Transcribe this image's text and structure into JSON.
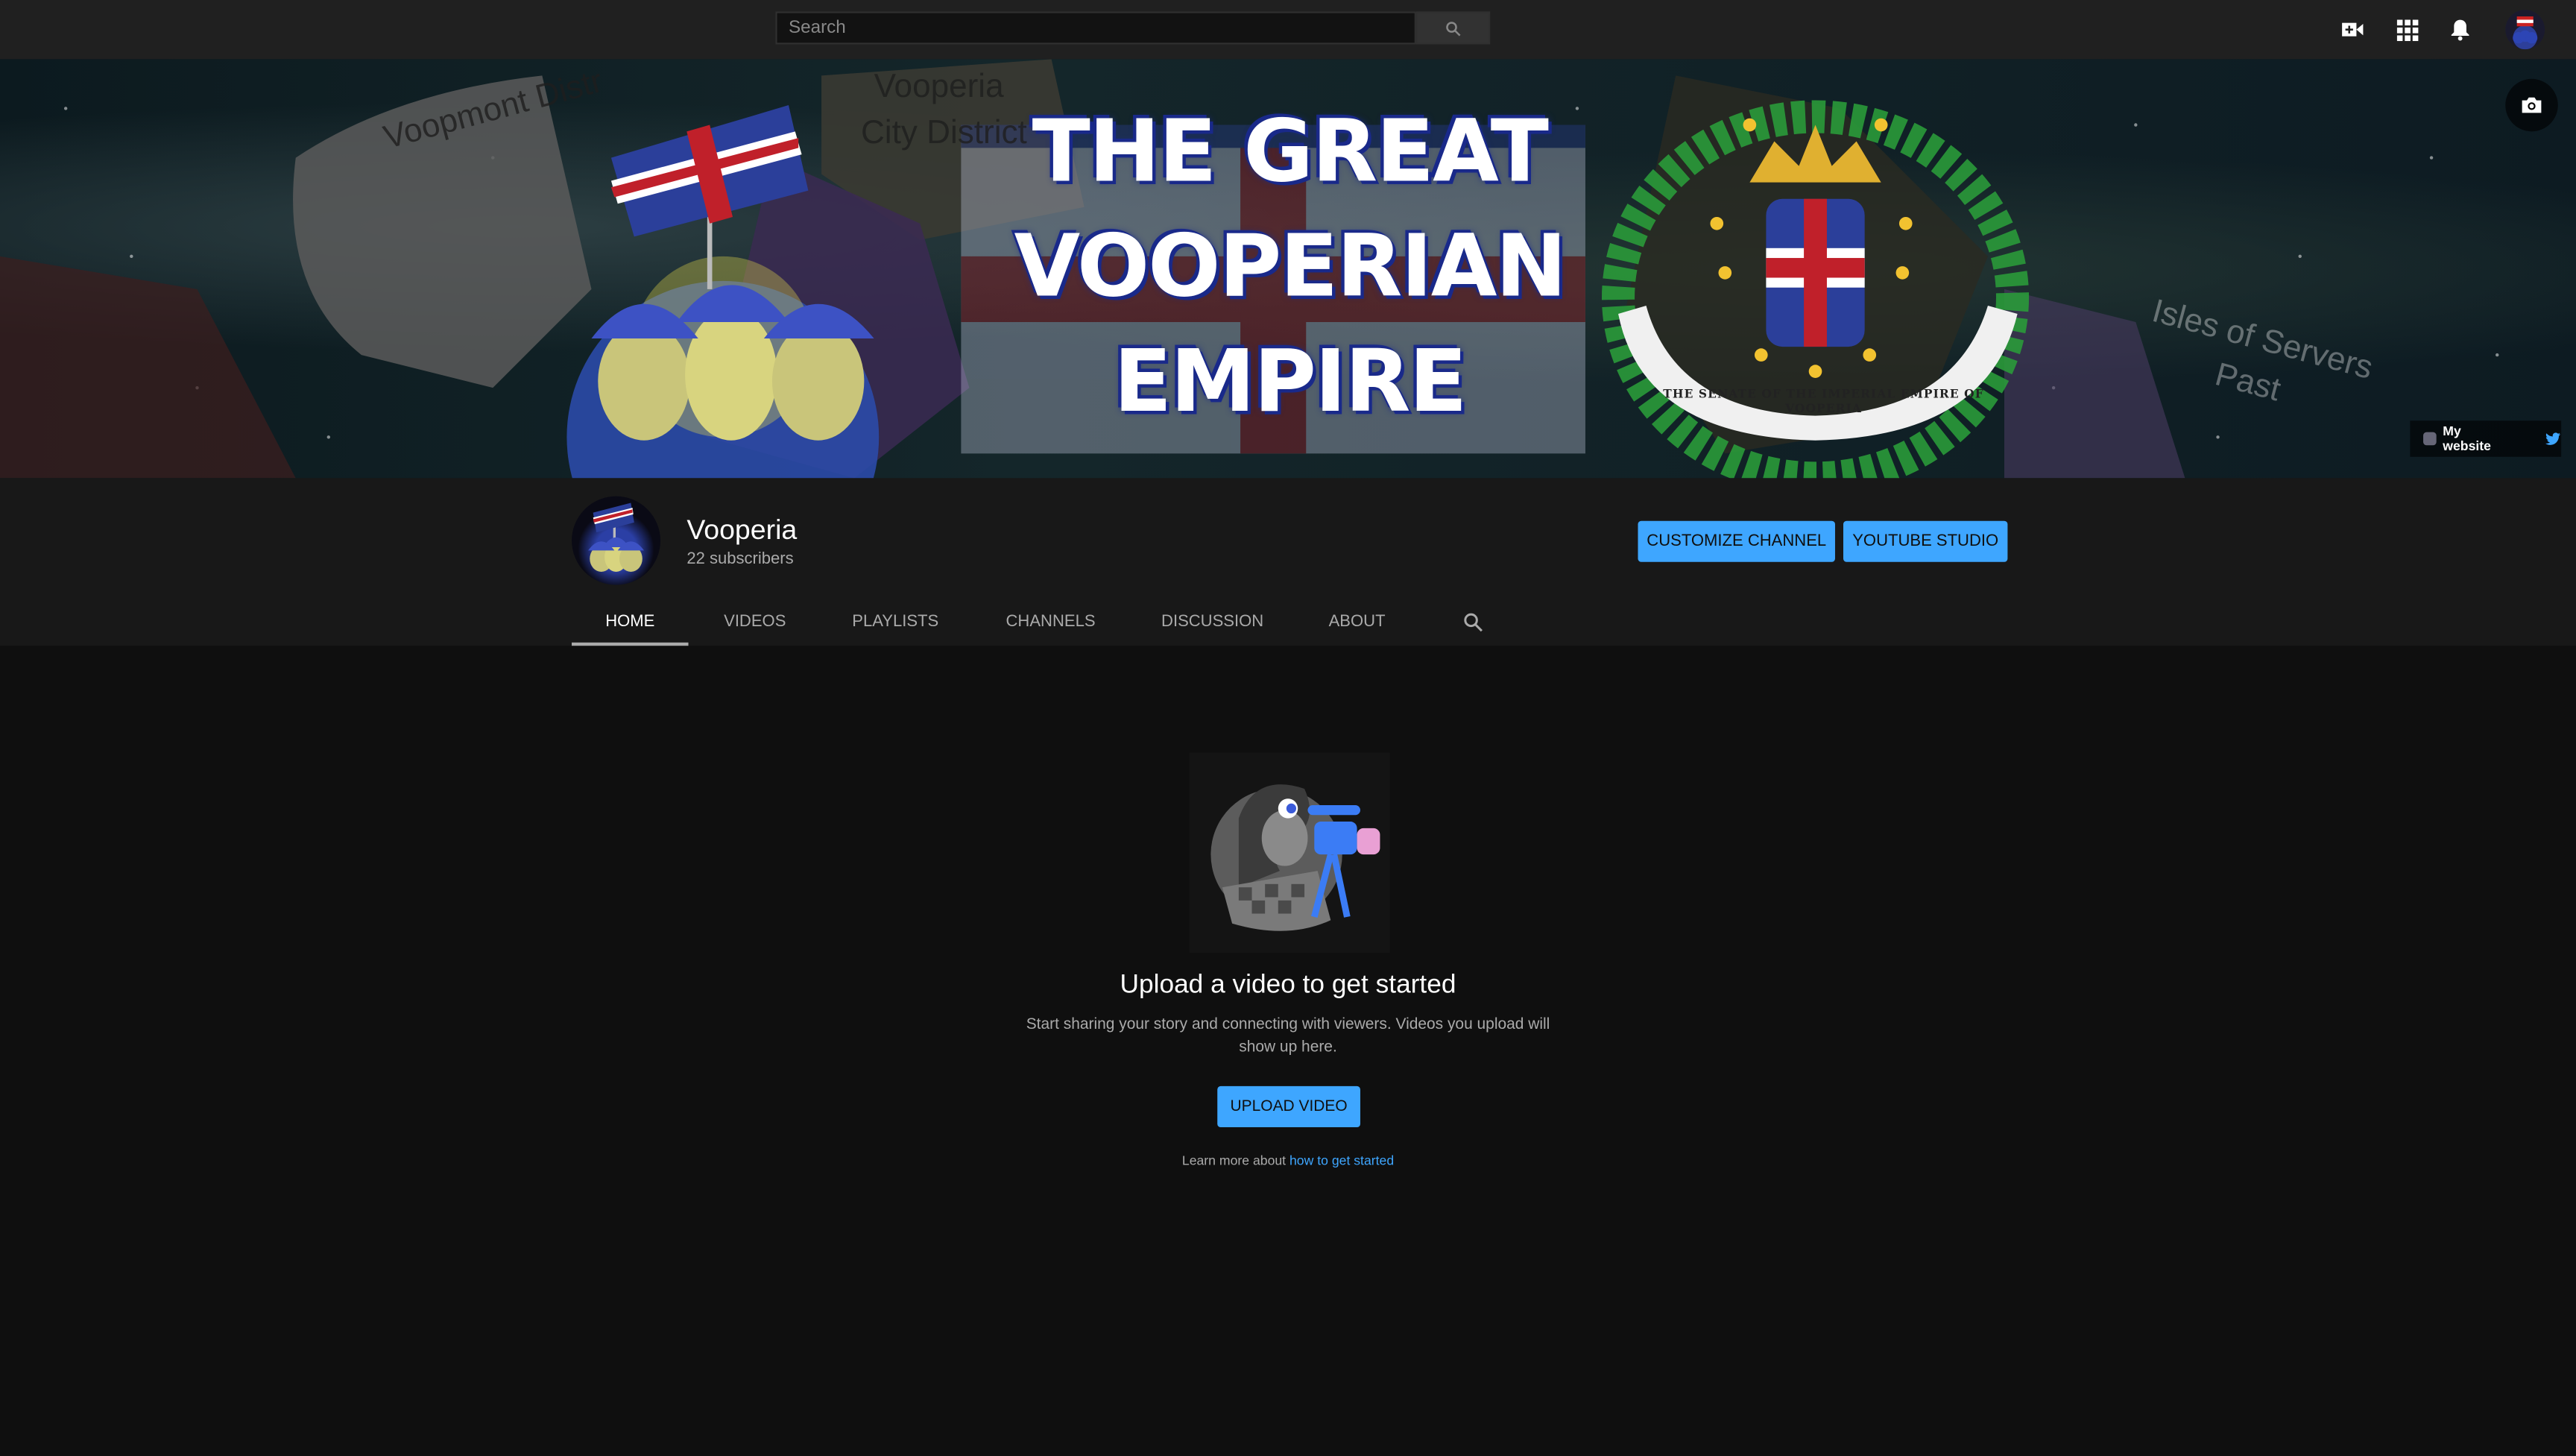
{
  "topbar": {
    "search_placeholder": "Search",
    "icons": [
      "search-icon",
      "create-video-icon",
      "apps-grid-icon",
      "notifications-bell-icon",
      "account-avatar"
    ]
  },
  "banner": {
    "title_lines": [
      "THE GREAT",
      "VOOPERIAN",
      "EMPIRE"
    ],
    "map_labels": [
      "Voopmont Distr",
      "Vooperia",
      "City District",
      "Isles of Servers",
      "Past"
    ],
    "seal_text": "THE SENATE OF THE IMPERIAL EMPIRE OF VOOPERIA",
    "link_label": "My website"
  },
  "channel": {
    "name": "Vooperia",
    "subscribers": "22 subscribers",
    "customize_label": "CUSTOMIZE CHANNEL",
    "studio_label": "YOUTUBE STUDIO"
  },
  "tabs": [
    {
      "label": "HOME",
      "active": true
    },
    {
      "label": "VIDEOS",
      "active": false
    },
    {
      "label": "PLAYLISTS",
      "active": false
    },
    {
      "label": "CHANNELS",
      "active": false
    },
    {
      "label": "DISCUSSION",
      "active": false
    },
    {
      "label": "ABOUT",
      "active": false
    }
  ],
  "empty_state": {
    "title": "Upload a video to get started",
    "description": "Start sharing your story and connecting with viewers. Videos you upload will show up here.",
    "upload_label": "UPLOAD VIDEO",
    "learn_prefix": "Learn more about ",
    "learn_link": "how to get started"
  },
  "colors": {
    "accent": "#3ea6ff",
    "background": "#0f0f0f",
    "header": "#181818",
    "topbar": "#202020"
  }
}
